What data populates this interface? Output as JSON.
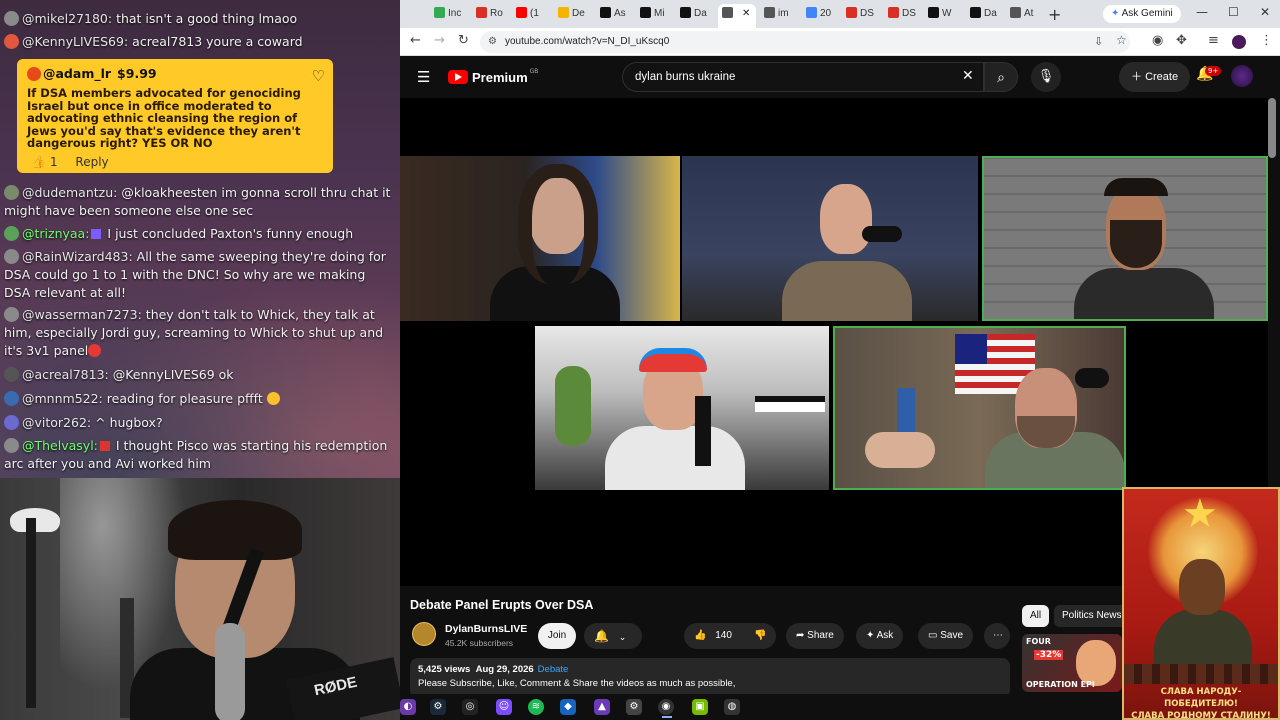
{
  "chat": {
    "messages": [
      {
        "user": "@mikel27180:",
        "text": "that isn't a good thing lmaoo",
        "avatar_color": "#8a8a8a"
      },
      {
        "user": "@KennyLIVES69:",
        "text": "acreal7813 youre a coward",
        "avatar_color": "#e2583e"
      },
      {
        "user": "@dudemantzu:",
        "text": "@kloakheesten im gonna scroll thru chat it might have been someone else one sec",
        "avatar_color": "#7a8a6a"
      },
      {
        "user": "@triznyaa:",
        "text": "I just concluded Paxton's funny enough",
        "avatar_color": "#5aa15a"
      },
      {
        "user": "@RainWizard483:",
        "text": "All the same sweeping they're doing for DSA could go 1 to 1 with the DNC! So why are we making DSA relevant at all!",
        "avatar_color": "#8a8a8a"
      },
      {
        "user": "@wasserman7273:",
        "text": "they don't talk to Whick, they talk at him, especially Jordi guy, screaming to Whick to shut up and it's 3v1 panel",
        "avatar_color": "#8a8a8a"
      },
      {
        "user": "@acreal7813:",
        "text": "@KennyLIVES69 ok",
        "avatar_color": "#555555"
      },
      {
        "user": "@mnnm522:",
        "text": "reading for pleasure pffft",
        "avatar_color": "#3a6ab0"
      },
      {
        "user": "@vitor262:",
        "text": "^ hugbox?",
        "avatar_color": "#6a6ad0"
      },
      {
        "user": "@Thelvasyl:",
        "text": "I thought Pisco was starting his redemption arc after you and Avi worked him",
        "avatar_color": "#8a8a8a"
      }
    ],
    "superchat": {
      "user": "@adam_lr",
      "amount": "$9.99",
      "text": "If DSA members advocated for genociding Israel but once in office moderated to advocating ethnic cleansing the region of Jews you'd say that's evidence they aren't dangerous right? YES OR NO",
      "likes": "1",
      "reply_label": "Reply"
    }
  },
  "webcam": {
    "brand_text": "RØDE"
  },
  "browser": {
    "tabs": [
      {
        "label": "Inc",
        "color": "#34a853"
      },
      {
        "label": "Ro",
        "color": "#d93025"
      },
      {
        "label": "(1",
        "color": "#ff0000"
      },
      {
        "label": "De",
        "color": "#f4b400"
      },
      {
        "label": "As",
        "color": "#111111"
      },
      {
        "label": "Mi",
        "color": "#111111"
      },
      {
        "label": "Da",
        "color": "#111111"
      },
      {
        "label": "",
        "color": "#555555"
      },
      {
        "label": "im",
        "color": "#555555"
      },
      {
        "label": "20",
        "color": "#4285f4"
      },
      {
        "label": "DS",
        "color": "#d93025"
      },
      {
        "label": "DS",
        "color": "#d93025"
      },
      {
        "label": "W",
        "color": "#111111"
      },
      {
        "label": "Da",
        "color": "#111111"
      },
      {
        "label": "At",
        "color": "#555555"
      }
    ],
    "new_tab": "+",
    "ask_gemini": "Ask Gemini",
    "url": "youtube.com/watch?v=N_DI_uKscq0"
  },
  "youtube": {
    "logo_text": "Premium",
    "logo_region": "GB",
    "search_query": "dylan burns ukraine",
    "create_label": "Create",
    "notification_count": "9+",
    "video_title": "Debate Panel Erupts Over DSA",
    "channel_name": "DylanBurnsLIVE",
    "subscribers": "45.2K subscribers",
    "join_label": "Join",
    "likes": "140",
    "share_label": "Share",
    "ask_label": "Ask",
    "save_label": "Save",
    "views": "5,425 views",
    "date": "Aug 29, 2026",
    "tag": "Debate",
    "description": "Please Subscribe, Like, Comment & Share the videos as much as possible,",
    "chips": [
      "All",
      "Politics News"
    ],
    "rec_thumb": {
      "top": "FOUR",
      "pct": "-32%",
      "bottom": "OPERATION EPI"
    }
  },
  "poster": {
    "slogan_line1": "СЛАВА НАРОДУ-ПОБЕДИТЕЛЮ!",
    "slogan_line2": "СЛАВА РОДНОМУ СТАЛИНУ!"
  }
}
